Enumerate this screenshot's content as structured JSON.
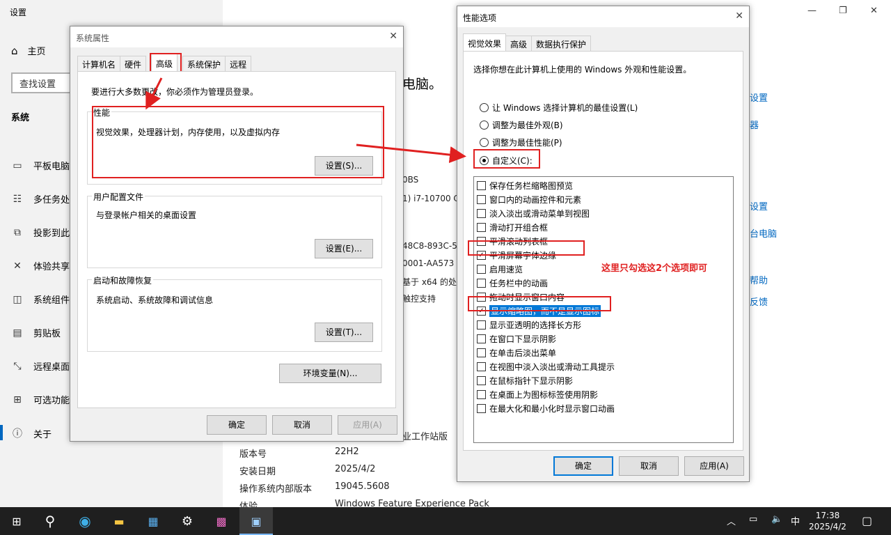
{
  "settings": {
    "title": "设置",
    "home": "主页",
    "search_placeholder": "查找设置",
    "section": "系统",
    "nav": [
      "平板电脑",
      "多任务处",
      "投影到此",
      "体验共享",
      "系统组件",
      "剪贴板",
      "远程桌面",
      "可选功能",
      "关于"
    ],
    "main_fragments": {
      "heading_frag": "电脑。",
      "link1": "设置",
      "link2": "器",
      "link3": "设置",
      "link4": "台电脑",
      "link5": "帮助",
      "link6": "反馈",
      "frag1": "0BS",
      "frag2": "1) i7-10700 C",
      "frag3": "48C8-893C-5",
      "frag4": "0001-AA573",
      "frag5": "基于 x64 的处",
      "frag6": "触控支持",
      "frag7": "业工作站版"
    },
    "info_rows": [
      {
        "label": "版本号",
        "value": "22H2"
      },
      {
        "label": "安装日期",
        "value": "2025/4/2"
      },
      {
        "label": "操作系统内部版本",
        "value": "19045.5608"
      },
      {
        "label": "体验",
        "value": "Windows Feature Experience Pack"
      }
    ]
  },
  "sysprops": {
    "title": "系统属性",
    "tabs": [
      "计算机名",
      "硬件",
      "高级",
      "系统保护",
      "远程"
    ],
    "admin_note": "要进行大多数更改，你必须作为管理员登录。",
    "perf_label": "性能",
    "perf_desc": "视觉效果，处理器计划，内存使用，以及虚拟内存",
    "perf_btn": "设置(S)...",
    "profile_label": "用户配置文件",
    "profile_desc": "与登录帐户相关的桌面设置",
    "profile_btn": "设置(E)...",
    "startup_label": "启动和故障恢复",
    "startup_desc": "系统启动、系统故障和调试信息",
    "startup_btn": "设置(T)...",
    "env_btn": "环境变量(N)...",
    "ok": "确定",
    "cancel": "取消",
    "apply": "应用(A)"
  },
  "perfopts": {
    "title": "性能选项",
    "tabs": [
      "视觉效果",
      "高级",
      "数据执行保护"
    ],
    "desc": "选择你想在此计算机上使用的 Windows 外观和性能设置。",
    "radios": [
      "让 Windows 选择计算机的最佳设置(L)",
      "调整为最佳外观(B)",
      "调整为最佳性能(P)",
      "自定义(C):"
    ],
    "checks": [
      {
        "label": "保存任务栏缩略图预览",
        "checked": false
      },
      {
        "label": "窗口内的动画控件和元素",
        "checked": false
      },
      {
        "label": "淡入淡出或滑动菜单到视图",
        "checked": false
      },
      {
        "label": "滑动打开组合框",
        "checked": false
      },
      {
        "label": "平滑滚动列表框",
        "checked": false
      },
      {
        "label": "平滑屏幕字体边缘",
        "checked": true
      },
      {
        "label": "启用速览",
        "checked": false
      },
      {
        "label": "任务栏中的动画",
        "checked": false
      },
      {
        "label": "拖动时显示窗口内容",
        "checked": false
      },
      {
        "label": "显示缩略图，而不是显示图标",
        "checked": true
      },
      {
        "label": "显示亚透明的选择长方形",
        "checked": false
      },
      {
        "label": "在窗口下显示阴影",
        "checked": false
      },
      {
        "label": "在单击后淡出菜单",
        "checked": false
      },
      {
        "label": "在视图中淡入淡出或滑动工具提示",
        "checked": false
      },
      {
        "label": "在鼠标指针下显示阴影",
        "checked": false
      },
      {
        "label": "在桌面上为图标标签使用阴影",
        "checked": false
      },
      {
        "label": "在最大化和最小化时显示窗口动画",
        "checked": false
      }
    ],
    "ok": "确定",
    "cancel": "取消",
    "apply": "应用(A)"
  },
  "annotation": "这里只勾选这2个选项即可",
  "taskbar": {
    "ime": "中",
    "time": "17:38",
    "date": "2025/4/2"
  },
  "colors": {
    "accent": "#0078d7",
    "annotation_red": "#e02020"
  }
}
